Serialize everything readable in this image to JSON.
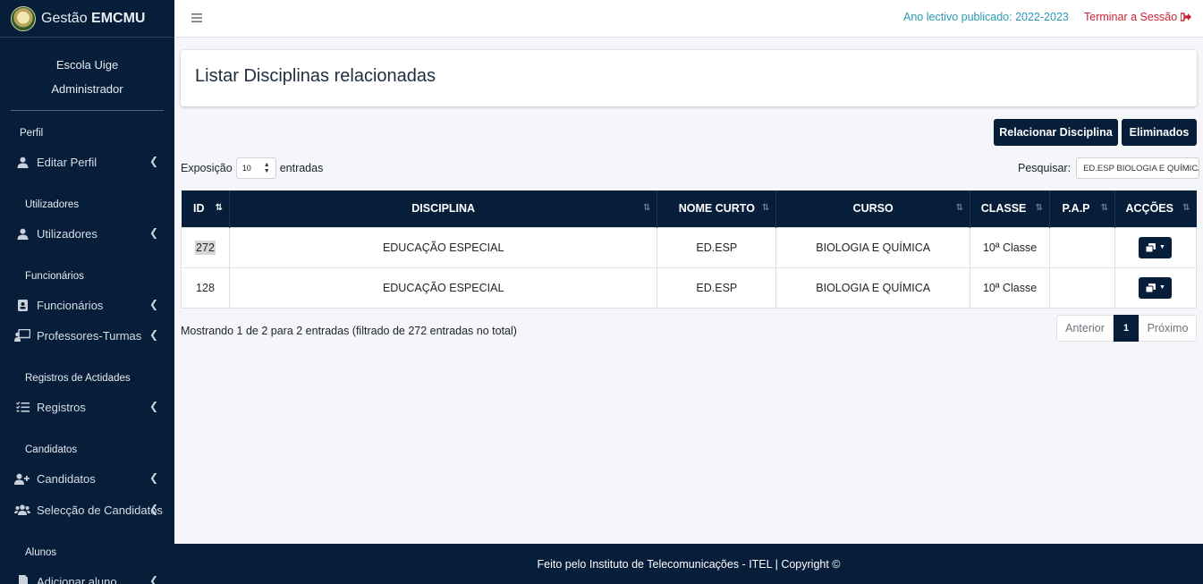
{
  "brand": {
    "name_prefix": "Gestão ",
    "name_bold": "EMCMU"
  },
  "user": {
    "school": "Escola Uige",
    "role": "Administrador"
  },
  "sidebar": {
    "sections": [
      {
        "header": "Perfil",
        "items": [
          {
            "label": "Editar Perfil",
            "icon": "user-icon"
          }
        ]
      },
      {
        "header": "Utilizadores",
        "items": [
          {
            "label": "Utilizadores",
            "icon": "user-icon"
          }
        ]
      },
      {
        "header": "Funcionários",
        "items": [
          {
            "label": "Funcionários",
            "icon": "id-badge-icon"
          },
          {
            "label": "Professores-Turmas",
            "icon": "chalkboard-teacher-icon"
          }
        ]
      },
      {
        "header": "Registros de Actidades",
        "items": [
          {
            "label": "Registros",
            "icon": "tasks-icon"
          }
        ]
      },
      {
        "header": "Candidatos",
        "items": [
          {
            "label": "Candidatos",
            "icon": "user-plus-icon"
          },
          {
            "label": "Selecção de Candidatos",
            "icon": "users-icon"
          }
        ]
      },
      {
        "header": "Alunos",
        "items": [
          {
            "label": "Adicionar aluno",
            "icon": "file-user-icon"
          }
        ]
      }
    ]
  },
  "topbar": {
    "year_text": "Ano lectivo publicado: 2022-2023",
    "logout_text": "Terminar a Sessão"
  },
  "page": {
    "title": "Listar Disciplinas relacionadas",
    "buttons": {
      "relate": "Relacionar Disciplina",
      "deleted": "Eliminados"
    },
    "length": {
      "prefix": "Exposição",
      "value": "10",
      "suffix": "entradas"
    },
    "search": {
      "label": "Pesquisar:",
      "value": "ED.ESP BIOLOGIA E QUÍMICA"
    },
    "table": {
      "columns": [
        "ID",
        "DISCIPLINA",
        "NOME CURTO",
        "CURSO",
        "CLASSE",
        "P.A.P",
        "ACÇÕES"
      ],
      "rows": [
        {
          "id": "272",
          "disciplina": "EDUCAÇÃO ESPECIAL",
          "nome_curto": "ED.ESP",
          "curso": "BIOLOGIA E QUÍMICA",
          "classe": "10ª Classe",
          "pap": ""
        },
        {
          "id": "128",
          "disciplina": "EDUCAÇÃO ESPECIAL",
          "nome_curto": "ED.ESP",
          "curso": "BIOLOGIA E QUÍMICA",
          "classe": "10ª Classe",
          "pap": ""
        }
      ]
    },
    "info": "Mostrando 1 de 2 para 2 entradas (filtrado de 272 entradas no total)",
    "pagination": {
      "prev": "Anterior",
      "current": "1",
      "next": "Próximo"
    }
  },
  "footer": {
    "text": "Feito pelo Instituto de Telecomunicações - ITEL | Copyright ©"
  },
  "colors": {
    "navy": "#061e3a",
    "teal_link": "#2b99b6",
    "logout_red": "#c82333"
  }
}
